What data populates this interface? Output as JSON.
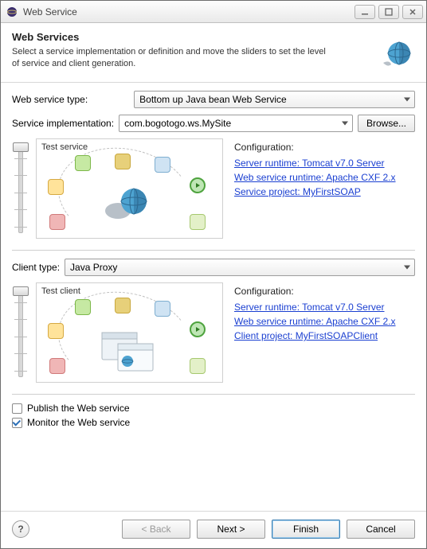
{
  "window": {
    "title": "Web Service"
  },
  "header": {
    "title": "Web Services",
    "description": "Select a service implementation or definition and move the sliders to set the level of service and client generation."
  },
  "service": {
    "type_label": "Web service type:",
    "type_value": "Bottom up Java bean Web Service",
    "impl_label": "Service implementation:",
    "impl_value": "com.bogotogo.ws.MySite",
    "browse_label": "Browse...",
    "preview_caption": "Test service",
    "config_label": "Configuration:",
    "links": {
      "runtime": "Server runtime: Tomcat v7.0 Server",
      "ws_runtime": "Web service runtime: Apache CXF 2.x",
      "project": "Service project: MyFirstSOAP"
    }
  },
  "client": {
    "type_label": "Client type:",
    "type_value": "Java Proxy",
    "preview_caption": "Test client",
    "config_label": "Configuration:",
    "links": {
      "runtime": "Server runtime: Tomcat v7.0 Server",
      "ws_runtime": "Web service runtime: Apache CXF 2.x",
      "project": "Client project: MyFirstSOAPClient"
    }
  },
  "options": {
    "publish_label": "Publish the Web service",
    "publish_checked": false,
    "monitor_label": "Monitor the Web service",
    "monitor_checked": true
  },
  "buttons": {
    "back": "< Back",
    "next": "Next >",
    "finish": "Finish",
    "cancel": "Cancel"
  }
}
